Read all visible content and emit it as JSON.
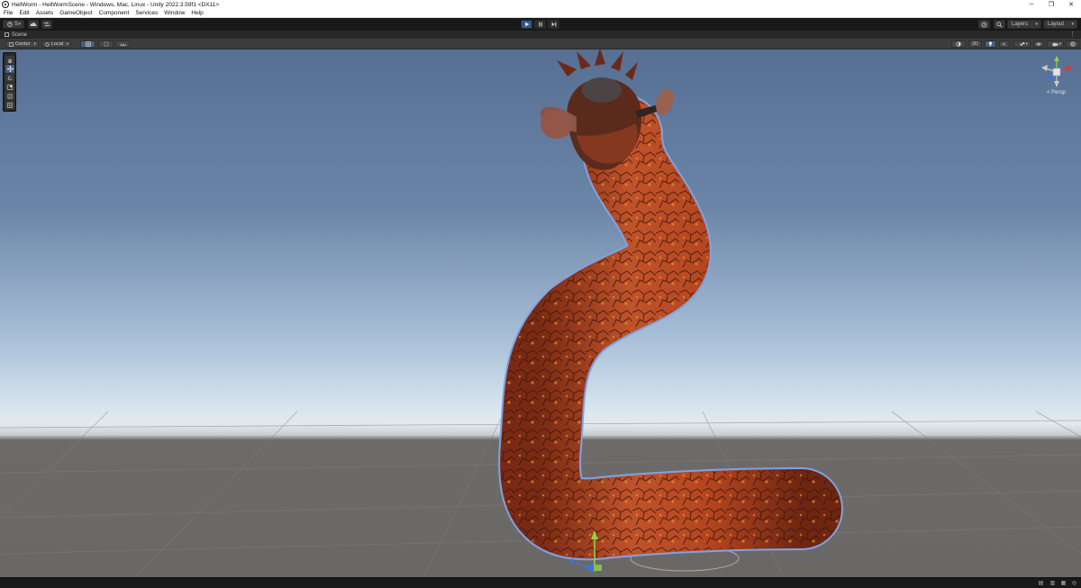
{
  "window": {
    "title": "HellWorm - HellWormScene - Windows, Mac, Linux - Unity 2022.3.59f1 <DX11>",
    "controls": {
      "minimize": "─",
      "maximize": "❐",
      "close": "✕"
    }
  },
  "menu": {
    "items": [
      "File",
      "Edit",
      "Assets",
      "GameObject",
      "Component",
      "Services",
      "Window",
      "Help"
    ]
  },
  "toolbar": {
    "account_label": "S",
    "account_icon": "account-icon",
    "cloud_icon": "cloud-icon",
    "collab_icon": "collab-icon",
    "play_icon": "play-icon",
    "pause_icon": "pause-icon",
    "step_icon": "step-icon",
    "history_icon": "history-icon",
    "search_icon": "search-icon",
    "layers_label": "Layers",
    "layout_label": "Layout"
  },
  "scene_tab": {
    "label": "Scene"
  },
  "scene_toolbar": {
    "pivot_label": "Center",
    "space_label": "Local",
    "mode_2d_label": "2D"
  },
  "gizmo": {
    "projection_label": "< Persp"
  },
  "colors": {
    "play_active": "#2d5a86",
    "x_axis": "#e0383d",
    "y_axis": "#8fd444",
    "z_axis": "#3a72e6",
    "worm_body": "#b64a22",
    "selection_outline": "#7fa2e6"
  }
}
